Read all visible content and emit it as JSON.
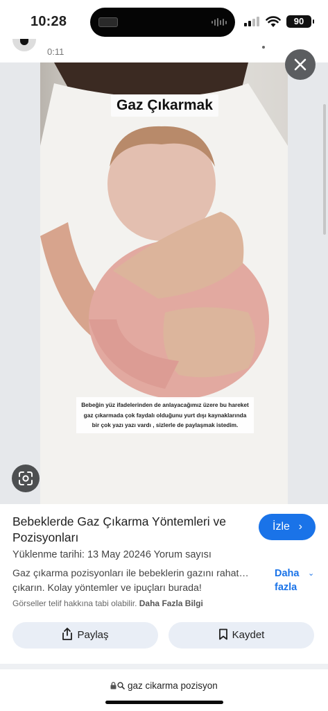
{
  "status_bar": {
    "time": "10:28",
    "battery": "90"
  },
  "previous_result": {
    "duration": "0:11"
  },
  "video": {
    "title_overlay": "Gaz Çıkarmak",
    "caption_overlay": "Bebeğin yüz ifadelerinden de anlayacağımız üzere bu hareket gaz çıkarmada çok faydalı olduğunu yurt dışı kaynaklarında bir çok yazı yazı vardı , sizlerle de paylaşmak istedim."
  },
  "result": {
    "title": "Bebeklerde Gaz Çıkarma Yöntemleri ve Pozisyonları",
    "watch_label": "İzle",
    "meta": "Yüklenme tarihi: 13 May 20246 Yorum sayısı",
    "description_line1": "Gaz çıkarma pozisyonları ile bebeklerin gazını rahat…",
    "description_line2": "çıkarın. Kolay yöntemler ve ipuçları burada!",
    "more_label_line1": "Daha",
    "more_label_line2": "fazla",
    "copyright_text": "Görseller telif hakkına tabi olabilir.",
    "copyright_link": "Daha Fazla Bilgi",
    "share_label": "Paylaş",
    "save_label": "Kaydet"
  },
  "browser": {
    "url": "gaz cikarma pozisyon"
  },
  "colors": {
    "accent": "#1a73e8",
    "button_bg": "#e9eef6"
  },
  "icons": [
    "close-icon",
    "google-lens-icon",
    "share-icon",
    "bookmark-icon",
    "lock-icon",
    "search-icon",
    "chevron-right-icon",
    "chevron-down-icon"
  ]
}
